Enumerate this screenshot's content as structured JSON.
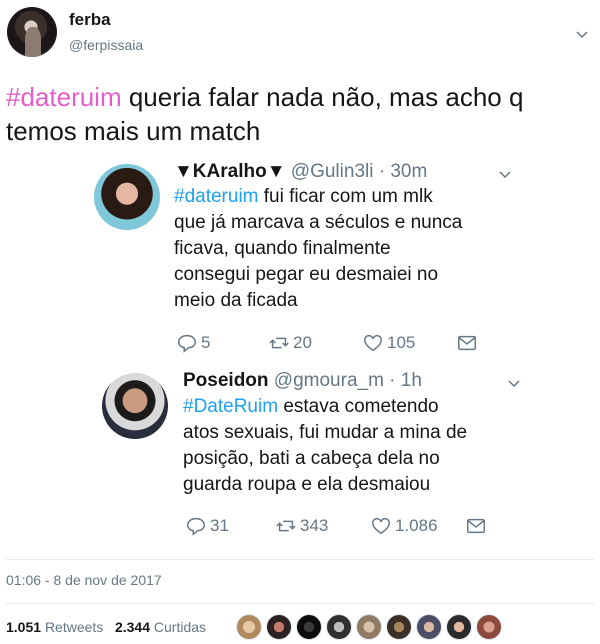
{
  "author": {
    "display_name": "ferba",
    "handle": "@ferpissaia"
  },
  "tweet": {
    "hashtag": "#dateruim",
    "text": "  queria falar nada não, mas acho q temos mais um match"
  },
  "quotes": [
    {
      "name": "▼KAralho▼",
      "handle": "@Gulin3li · 30m",
      "hashtag": "#dateruim",
      "lines": [
        " fui ficar com um mlk",
        "que já marcava a séculos e nunca",
        "ficava, quando finalmente",
        "consegui pegar eu desmaiei no",
        "meio da ficada"
      ],
      "replies": "5",
      "retweets": "20",
      "likes": "105"
    },
    {
      "name": "Poseidon",
      "handle": "@gmoura_m · 1h",
      "hashtag": "#DateRuim",
      "lines": [
        " estava cometendo",
        "atos sexuais, fui mudar a mina de",
        "posição, bati a cabeça dela no",
        "guarda roupa e ela desmaiou"
      ],
      "replies": "31",
      "retweets": "343",
      "likes": "1.086"
    }
  ],
  "timestamp": "01:06 - 8 de nov de 2017",
  "stats": {
    "retweets_count": "1.051",
    "retweets_label": "Retweets",
    "likes_count": "2.344",
    "likes_label": "Curtidas"
  },
  "colors": {
    "hashtag_main": "#e35ec8",
    "hashtag_link": "#1da1f2",
    "muted": "#657786"
  },
  "icons": [
    "chevron-down-icon",
    "reply-icon",
    "retweet-icon",
    "heart-icon",
    "mail-icon"
  ]
}
